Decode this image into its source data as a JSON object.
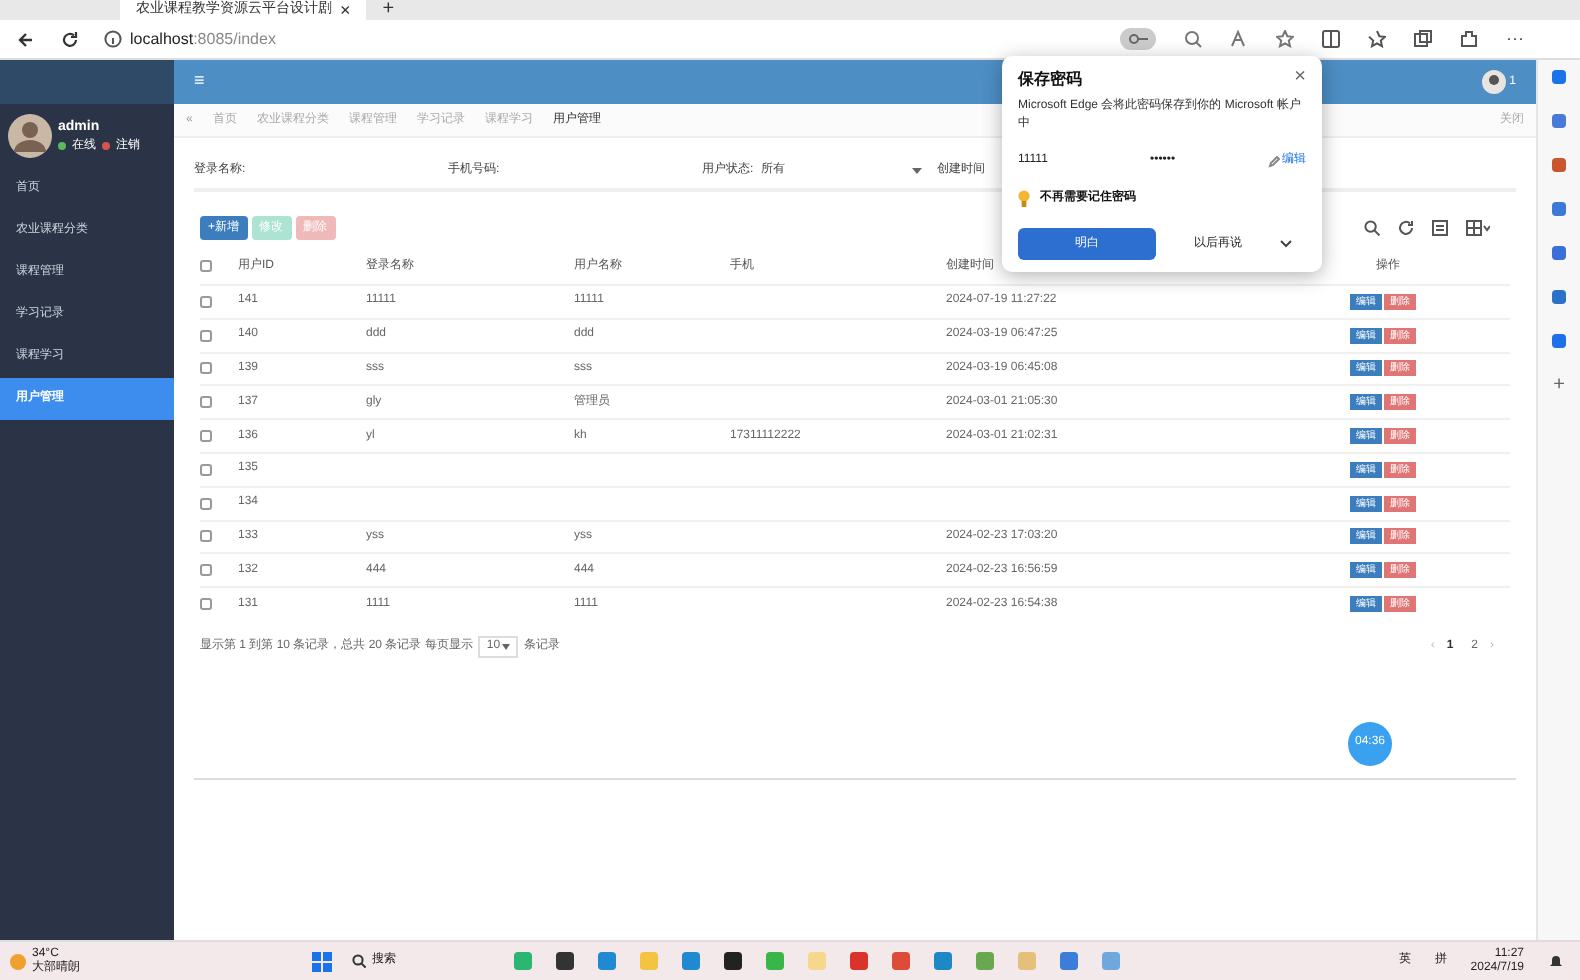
{
  "browser": {
    "tab_title": "农业课程教学资源云平台设计剧",
    "tab_close": "×",
    "new_tab": "+",
    "url_host": "localhost",
    "url_rest": ":8085/index"
  },
  "sidebar": {
    "user": "admin",
    "online": "在线",
    "logout": "注销",
    "items": [
      {
        "label": "首页",
        "selected": false
      },
      {
        "label": "农业课程分类",
        "selected": false
      },
      {
        "label": "课程管理",
        "selected": false
      },
      {
        "label": "学习记录",
        "selected": false
      },
      {
        "label": "课程学习",
        "selected": false
      },
      {
        "label": "用户管理",
        "selected": true
      }
    ]
  },
  "browser_more": "···",
  "edge_add": "+",
  "header": {
    "menu_glyph": "≡",
    "badge": "1"
  },
  "breadcrumb_scroll": "«",
  "breadcrumb_tabs": [
    {
      "label": "首页",
      "selected": false
    },
    {
      "label": "农业课程分类",
      "selected": false
    },
    {
      "label": "课程管理",
      "selected": false
    },
    {
      "label": "学习记录",
      "selected": false
    },
    {
      "label": "课程学习",
      "selected": false
    },
    {
      "label": "用户管理",
      "selected": true
    }
  ],
  "breadcrumb_tail": "关闭",
  "search": {
    "login_label": "登录名称:",
    "phone_label": "手机号码:",
    "status_label": "用户状态:",
    "status_value": "所有",
    "created_label": "创建时间"
  },
  "toolbar": [
    {
      "label": "+新增",
      "kind": "add",
      "disabled": false
    },
    {
      "label": "修改",
      "kind": "edit",
      "disabled": true
    },
    {
      "label": "删除",
      "kind": "delete",
      "disabled": true
    }
  ],
  "table": {
    "header_checked": false,
    "columns": [
      "用户ID",
      "登录名称",
      "用户名称",
      "手机",
      "创建时间",
      "操作"
    ],
    "rows": [
      {
        "checked": false,
        "id": "141",
        "login": "11111",
        "name": "11111",
        "created": "2024-07-19 11:27:22",
        "edit": "编辑",
        "delete": "删除"
      },
      {
        "checked": false,
        "id": "140",
        "login": "ddd",
        "name": "ddd",
        "created": "2024-03-19 06:47:25",
        "edit": "编辑",
        "delete": "删除"
      },
      {
        "checked": false,
        "id": "139",
        "login": "sss",
        "name": "sss",
        "created": "2024-03-19 06:45:08",
        "edit": "编辑",
        "delete": "删除"
      },
      {
        "checked": false,
        "id": "137",
        "login": "gly",
        "name": "管理员",
        "created": "2024-03-01 21:05:30",
        "edit": "编辑",
        "delete": "删除"
      },
      {
        "checked": false,
        "id": "136",
        "login": "yl",
        "name": "kh",
        "phone": "17311112222",
        "created": "2024-03-01 21:02:31",
        "edit": "编辑",
        "delete": "删除"
      },
      {
        "checked": false,
        "id": "135",
        "edit": "编辑",
        "delete": "删除"
      },
      {
        "checked": false,
        "id": "134",
        "edit": "编辑",
        "delete": "删除"
      },
      {
        "checked": false,
        "id": "133",
        "login": "yss",
        "name": "yss",
        "created": "2024-02-23 17:03:20",
        "edit": "编辑",
        "delete": "删除"
      },
      {
        "checked": false,
        "id": "132",
        "login": "444",
        "name": "444",
        "created": "2024-02-23 16:56:59",
        "edit": "编辑",
        "delete": "删除"
      },
      {
        "checked": false,
        "id": "131",
        "login": "1111",
        "name": "1111",
        "created": "2024-02-23 16:54:38",
        "edit": "编辑",
        "delete": "删除"
      }
    ]
  },
  "pagination": {
    "summary": "显示第 1 到第 10 条记录，总共 20 条记录 每页显示",
    "page_size": "10",
    "suffix": "条记录",
    "pages": [
      {
        "label": "1",
        "selected": true
      },
      {
        "label": "2",
        "selected": false
      }
    ],
    "prev": "‹",
    "next": "›"
  },
  "timer": "04:36",
  "password_popup": {
    "title": "保存密码",
    "message": "Microsoft Edge 会将此密码保存到你的 Microsoft 帐户中",
    "username": "11111",
    "password": "••••••",
    "edit": "编辑",
    "never": "不再需要记住密码",
    "confirm": "明白",
    "later": "以后再说",
    "close": "×"
  },
  "taskbar": {
    "temp": "34°C",
    "weather": "大部晴朗",
    "search": "搜索",
    "lang": "英",
    "ime": "拼",
    "time": "11:27",
    "date": "2024/7/19"
  }
}
